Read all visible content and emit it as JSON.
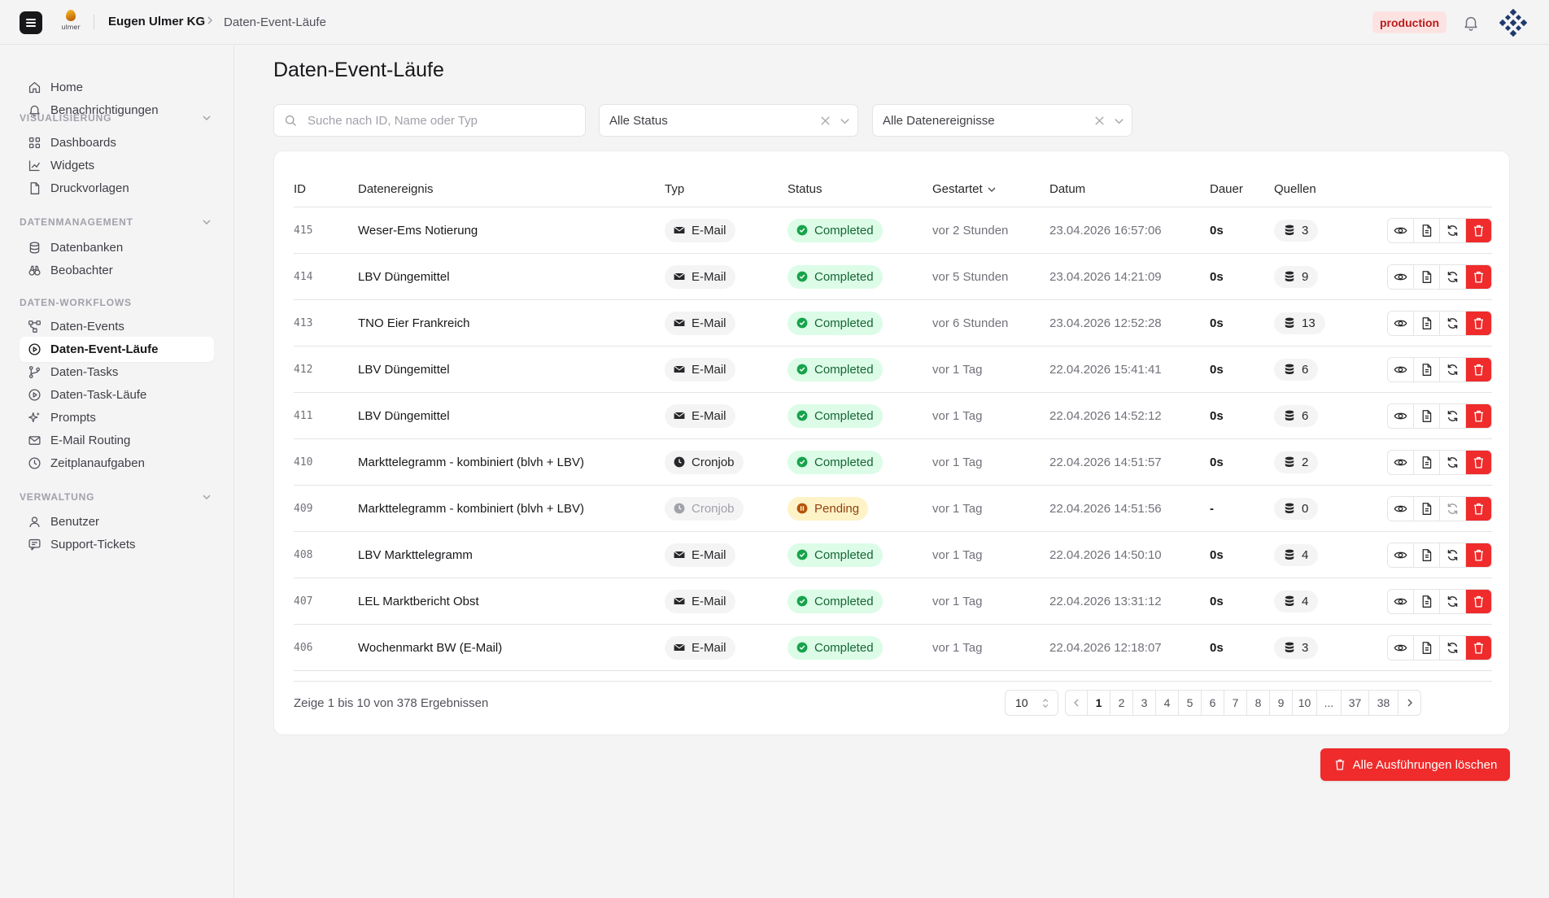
{
  "header": {
    "logo_text": "ulmer",
    "company": "Eugen Ulmer KG",
    "breadcrumb_current": "Daten-Event-Läufe",
    "environment_badge": "production"
  },
  "sidebar": {
    "top_items": [
      {
        "label": "Home",
        "icon": "home-icon"
      },
      {
        "label": "Benachrichtigungen",
        "icon": "bell-icon"
      }
    ],
    "sections": [
      {
        "title": "VISUALISIERUNG",
        "items": [
          {
            "label": "Dashboards",
            "icon": "grid-icon"
          },
          {
            "label": "Widgets",
            "icon": "chart-icon"
          },
          {
            "label": "Druckvorlagen",
            "icon": "file-icon"
          }
        ]
      },
      {
        "title": "DATENMANAGEMENT",
        "items": [
          {
            "label": "Datenbanken",
            "icon": "database-icon"
          },
          {
            "label": "Beobachter",
            "icon": "binoculars-icon"
          }
        ]
      },
      {
        "title": "DATEN-WORKFLOWS",
        "items": [
          {
            "label": "Daten-Events",
            "icon": "workflow-icon"
          },
          {
            "label": "Daten-Event-Läufe",
            "icon": "play-circle-icon",
            "active": true
          },
          {
            "label": "Daten-Tasks",
            "icon": "git-branch-icon"
          },
          {
            "label": "Daten-Task-Läufe",
            "icon": "play-circle-icon"
          },
          {
            "label": "Prompts",
            "icon": "sparkles-icon"
          },
          {
            "label": "E-Mail Routing",
            "icon": "mail-icon"
          },
          {
            "label": "Zeitplanaufgaben",
            "icon": "clock-icon"
          }
        ]
      },
      {
        "title": "VERWALTUNG",
        "items": [
          {
            "label": "Benutzer",
            "icon": "user-icon"
          },
          {
            "label": "Support-Tickets",
            "icon": "message-icon"
          }
        ]
      }
    ]
  },
  "main": {
    "title": "Daten-Event-Läufe",
    "search_placeholder": "Suche nach ID, Name oder Typ",
    "filter_status": "Alle Status",
    "filter_events": "Alle Datenereignisse",
    "columns": {
      "id": "ID",
      "event": "Datenereignis",
      "type": "Typ",
      "status": "Status",
      "started": "Gestartet",
      "date": "Datum",
      "duration": "Dauer",
      "sources": "Quellen"
    },
    "rows": [
      {
        "id": "415",
        "event": "Weser-Ems Notierung",
        "type": "E-Mail",
        "status": "Completed",
        "started": "vor 2 Stunden",
        "date": "23.04.2026 16:57:06",
        "duration": "0s",
        "sources": "3"
      },
      {
        "id": "414",
        "event": "LBV Düngemittel",
        "type": "E-Mail",
        "status": "Completed",
        "started": "vor 5 Stunden",
        "date": "23.04.2026 14:21:09",
        "duration": "0s",
        "sources": "9"
      },
      {
        "id": "413",
        "event": "TNO Eier Frankreich",
        "type": "E-Mail",
        "status": "Completed",
        "started": "vor 6 Stunden",
        "date": "23.04.2026 12:52:28",
        "duration": "0s",
        "sources": "13"
      },
      {
        "id": "412",
        "event": "LBV Düngemittel",
        "type": "E-Mail",
        "status": "Completed",
        "started": "vor 1 Tag",
        "date": "22.04.2026 15:41:41",
        "duration": "0s",
        "sources": "6"
      },
      {
        "id": "411",
        "event": "LBV Düngemittel",
        "type": "E-Mail",
        "status": "Completed",
        "started": "vor 1 Tag",
        "date": "22.04.2026 14:52:12",
        "duration": "0s",
        "sources": "6"
      },
      {
        "id": "410",
        "event": "Markttelegramm - kombiniert (blvh + LBV)",
        "type": "Cronjob",
        "status": "Completed",
        "started": "vor 1 Tag",
        "date": "22.04.2026 14:51:57",
        "duration": "0s",
        "sources": "2"
      },
      {
        "id": "409",
        "event": "Markttelegramm - kombiniert (blvh + LBV)",
        "type": "Cronjob",
        "status": "Pending",
        "started": "vor 1 Tag",
        "date": "22.04.2026 14:51:56",
        "duration": "-",
        "sources": "0"
      },
      {
        "id": "408",
        "event": "LBV Markttelegramm",
        "type": "E-Mail",
        "status": "Completed",
        "started": "vor 1 Tag",
        "date": "22.04.2026 14:50:10",
        "duration": "0s",
        "sources": "4"
      },
      {
        "id": "407",
        "event": "LEL Marktbericht Obst",
        "type": "E-Mail",
        "status": "Completed",
        "started": "vor 1 Tag",
        "date": "22.04.2026 13:31:12",
        "duration": "0s",
        "sources": "4"
      },
      {
        "id": "406",
        "event": "Wochenmarkt BW (E-Mail)",
        "type": "E-Mail",
        "status": "Completed",
        "started": "vor 1 Tag",
        "date": "22.04.2026 12:18:07",
        "duration": "0s",
        "sources": "3"
      }
    ],
    "summary": "Zeige 1 bis 10 von 378 Ergebnissen",
    "per_page": "10",
    "pages": [
      "1",
      "2",
      "3",
      "4",
      "5",
      "6",
      "7",
      "8",
      "9",
      "10",
      "...",
      "37",
      "38"
    ],
    "current_page": "1",
    "delete_all_label": "Alle Ausführungen löschen"
  },
  "colors": {
    "accent_red": "#ef2b2b",
    "completed_bg": "#dcfce7",
    "completed_fg": "#166534",
    "pending_bg": "#fef3c7",
    "pending_fg": "#92400e",
    "env_badge_bg": "#fde2e2"
  }
}
